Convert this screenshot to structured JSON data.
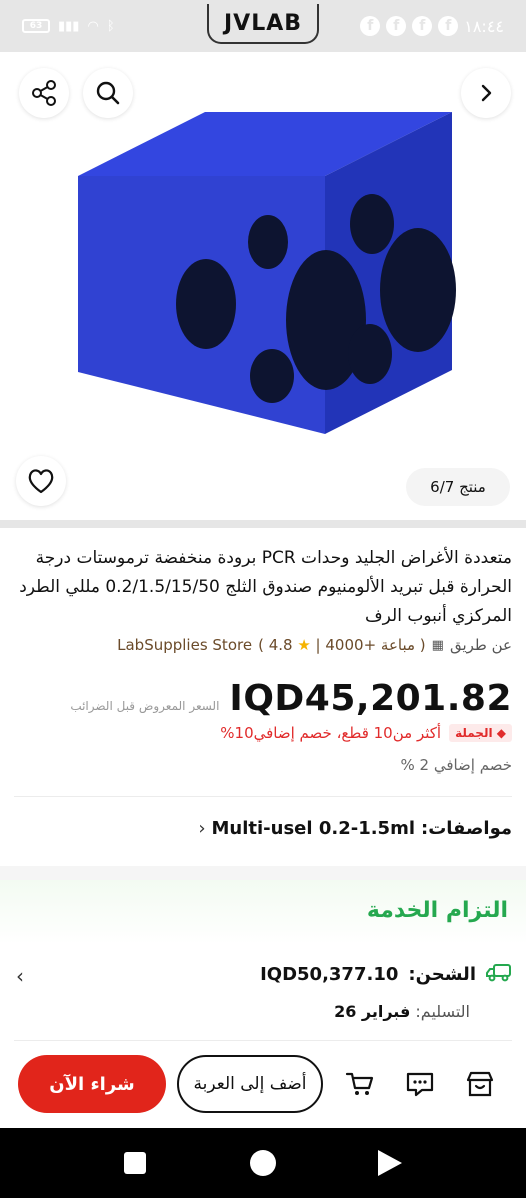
{
  "status_bar": {
    "time": "١٨:٤٤",
    "battery": "63",
    "brand": "JVLAB"
  },
  "image": {
    "counter": "منتج 6/7"
  },
  "product": {
    "title": "متعددة الأغراض الجليد وحدات PCR برودة منخفضة ترموستات درجة الحرارة قبل تبريد الألومنيوم صندوق الثلج 0.2/1.5/15/50 مللي الطرد المركزي أنبوب الرف",
    "seller_prefix": "عن طريق",
    "sold": "مباعة +4000",
    "rating": "4.8",
    "store": "LabSupplies Store"
  },
  "price": {
    "amount": "IQD45,201.82",
    "note": "السعر المعروض قبل الضرائب"
  },
  "wholesale": {
    "badge": "الجملة",
    "deal": "أكثر من10 قطع، خصم إضافي10%"
  },
  "extra_discount": "خصم إضافي 2 %",
  "specs": {
    "label": "مواصفات:",
    "value": "Multi-usel 0.2-1.5ml"
  },
  "service": {
    "title": "التزام الخدمة",
    "shipping_label": "الشحن:",
    "shipping_value": "IQD50,377.10",
    "delivery_label": "التسليم:",
    "delivery_value": "فبراير 26"
  },
  "actions": {
    "buy_now": "شراء الآن",
    "add_to_cart": "أضف إلى العربة"
  },
  "colors": {
    "accent_red": "#e1251b",
    "service_green": "#25a84f",
    "product_blue": "#2f3fd0"
  }
}
